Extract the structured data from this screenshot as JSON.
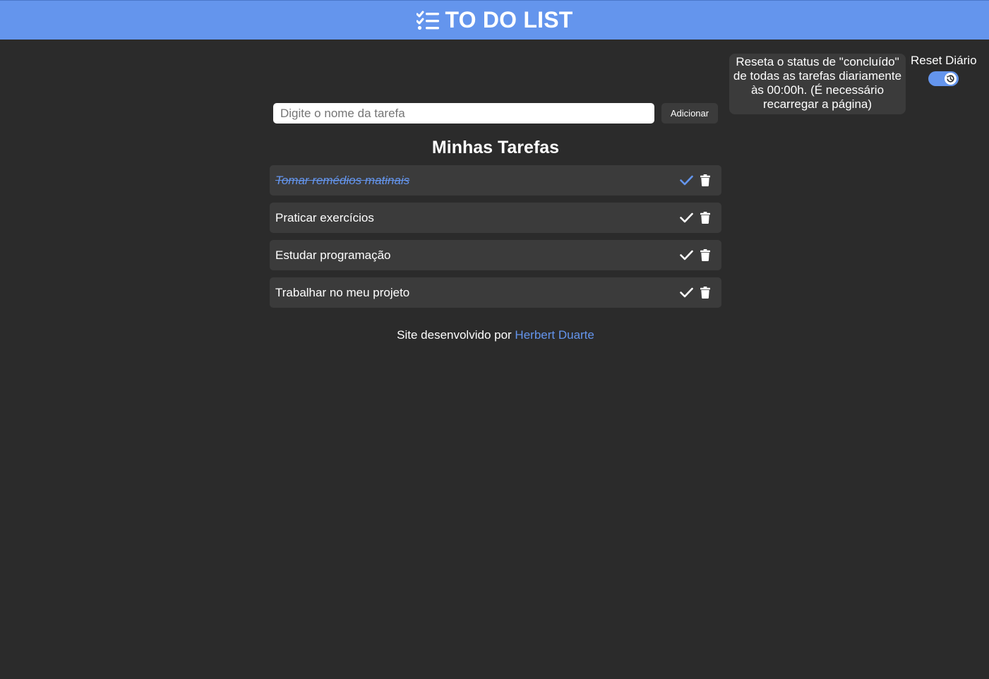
{
  "header": {
    "icon": "checklist-icon",
    "title": "TO DO LIST"
  },
  "reset": {
    "tooltip": "Reseta o status de \"concluído\" de todas as tarefas diariamente às 00:00h. (É necessário recarregar a página)",
    "label": "Reset Diário",
    "toggle_on": true,
    "toggle_icon": "history-icon"
  },
  "form": {
    "placeholder": "Digite o nome da tarefa",
    "value": "",
    "add_label": "Adicionar"
  },
  "section": {
    "title": "Minhas Tarefas"
  },
  "tasks": [
    {
      "text": "Tomar remédios matinais",
      "done": true
    },
    {
      "text": "Praticar exercícios",
      "done": false
    },
    {
      "text": "Estudar programação",
      "done": false
    },
    {
      "text": "Trabalhar no meu projeto",
      "done": false
    }
  ],
  "footer": {
    "prefix": "Site desenvolvido por",
    "author": "Herbert Duarte"
  },
  "colors": {
    "accent": "#6495ed",
    "background": "#2b2b2b",
    "card": "#3b3b3b"
  }
}
